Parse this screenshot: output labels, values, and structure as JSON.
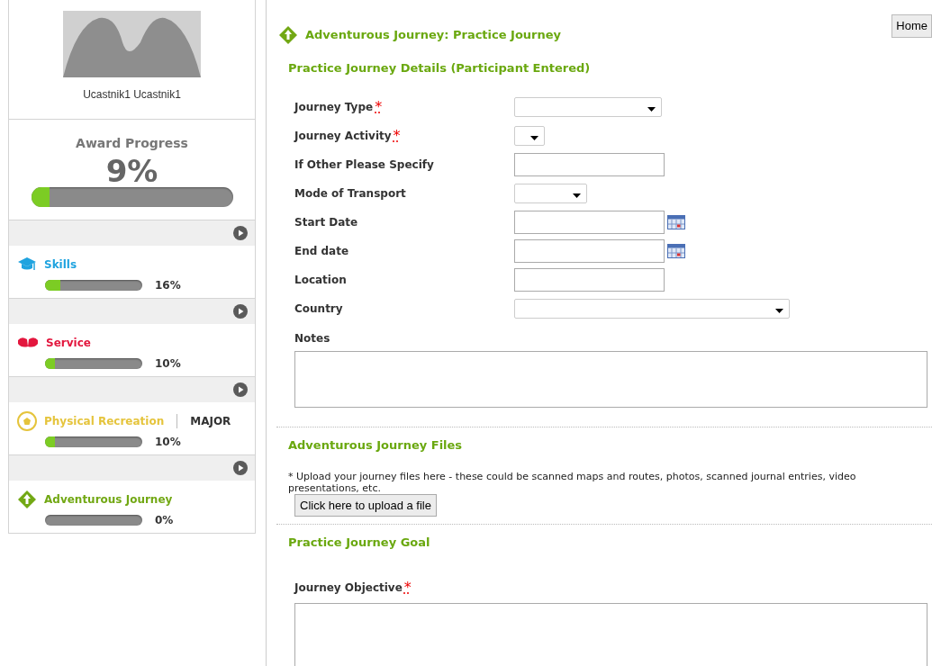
{
  "profile": {
    "name": "Ucastnik1 Ucastnik1"
  },
  "award_progress": {
    "title": "Award Progress",
    "reading": "9%",
    "level": 0.09
  },
  "categories": [
    {
      "kind": "skills",
      "name": "Skills",
      "color": "#1fa3df",
      "level": 0.16,
      "reading": "16%"
    },
    {
      "kind": "service",
      "name": "Service",
      "color": "#e3173e",
      "level": 0.1,
      "reading": "10%"
    },
    {
      "kind": "physical",
      "name": "Physical Recreation",
      "color": "#e5c43c",
      "level": 0.1,
      "reading": "10%",
      "tag": "MAJOR"
    },
    {
      "kind": "journey",
      "name": "Adventurous Journey",
      "color": "#72a814",
      "level": 0,
      "reading": "0%"
    }
  ],
  "home_button": "Home",
  "page_title": "Adventurous Journey: Practice Journey",
  "details": {
    "title": "Practice Journey Details (Participant Entered)",
    "fields": [
      {
        "kind": "select",
        "label": "Journey Type",
        "required_mark": "*"
      },
      {
        "kind": "select",
        "label": "Journey Activity",
        "required_mark": "*"
      },
      {
        "kind": "text",
        "label": "If Other Please Specify"
      },
      {
        "kind": "select",
        "label": "Mode of Transport"
      },
      {
        "kind": "date",
        "label": "Start Date"
      },
      {
        "kind": "date",
        "label": "End date"
      },
      {
        "kind": "text",
        "label": "Location"
      },
      {
        "kind": "select",
        "label": "Country"
      },
      {
        "kind": "textarea",
        "label": "Notes"
      }
    ]
  },
  "files": {
    "title": "Adventurous Journey Files",
    "note": "* Upload your journey files here - these could be scanned maps and routes, photos, scanned journal entries, video presentations, etc.",
    "upload_button": "Click here to upload a file"
  },
  "goal": {
    "title": "Practice Journey Goal",
    "objective_label": "Journey Objective",
    "required_mark": "*"
  }
}
